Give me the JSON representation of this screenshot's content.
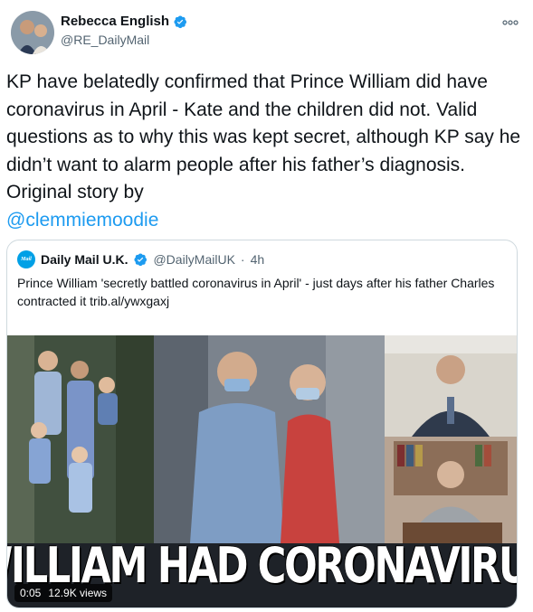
{
  "author": {
    "name": "Rebecca English",
    "handle": "@RE_DailyMail"
  },
  "tweet": {
    "text": "KP have belatedly confirmed that Prince William did have coronavirus in April - Kate and the children did not. Valid questions as to why this was kept secret, although KP say he didn’t want to alarm people after his father’s diagnosis. Original story by",
    "mention": "@clemmiemoodie"
  },
  "quote": {
    "avatar_text": "Mail",
    "name": "Daily Mail U.K.",
    "handle": "@DailyMailUK",
    "separator": "·",
    "time": "4h",
    "text": "Prince William 'secretly battled coronavirus in April' - just days after his father Charles contracted it trib.al/ywxgaxj",
    "headline": "WILLIAM HAD CORONAVIRUS",
    "video_time": "0:05",
    "views": "12.9K views"
  },
  "colors": {
    "accent": "#1d9bf0",
    "muted": "#536471",
    "border": "#cfd9de"
  },
  "icons": {
    "verified": "verified-badge-icon",
    "more": "more-options-icon"
  }
}
